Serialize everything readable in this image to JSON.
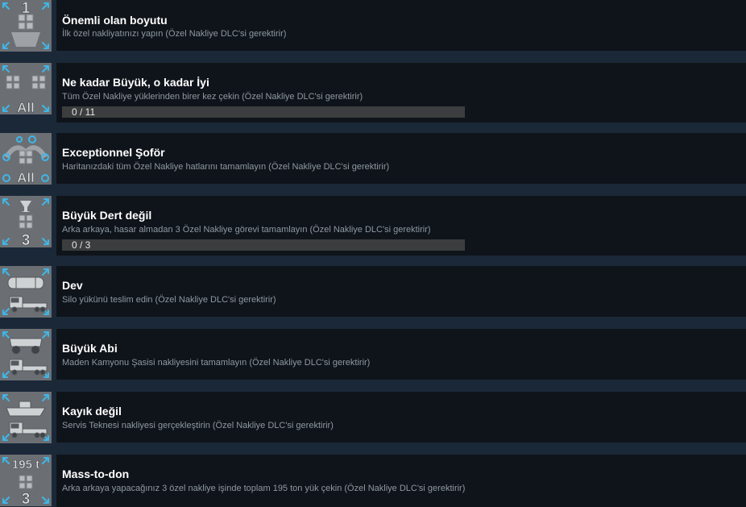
{
  "colors": {
    "background": "#1b2838",
    "panel": "#0f141a",
    "icon_bg": "#6b6f73",
    "icon_accent": "#3fb6e8",
    "title": "#ffffff",
    "description": "#8f98a0",
    "progress_track": "#3c3d3e"
  },
  "achievements": [
    {
      "title": "Önemli olan boyutu",
      "description": "İlk özel nakliyatınızı yapın (Özel Nakliye DLC'si gerektirir)",
      "icon": "number-one-crate-icon",
      "icon_label": "1"
    },
    {
      "title": "Ne kadar Büyük, o kadar İyi",
      "description": "Tüm Özel Nakliye yüklerinden birer kez çekin (Özel Nakliye DLC'si gerektirir)",
      "icon": "all-crates-icon",
      "icon_label": "All",
      "progress": {
        "current": 0,
        "total": 11,
        "text": "0 / 11"
      }
    },
    {
      "title": "Exceptionnel Şoför",
      "description": "Haritanızdaki tüm Özel Nakliye hatlarını tamamlayın (Özel Nakliye DLC'si gerektirir)",
      "icon": "all-routes-icon",
      "icon_label": "All"
    },
    {
      "title": "Büyük Dert değil",
      "description": "Arka arkaya, hasar almadan 3 Özel Nakliye görevi tamamlayın (Özel Nakliye DLC'si gerektirir)",
      "icon": "fragile-glass-icon",
      "icon_label": "3",
      "progress": {
        "current": 0,
        "total": 3,
        "text": "0 / 3"
      }
    },
    {
      "title": "Dev",
      "description": "Silo yükünü teslim edin (Özel Nakliye DLC'si gerektirir)",
      "icon": "silo-truck-icon",
      "icon_label": ""
    },
    {
      "title": "Büyük Abi",
      "description": "Maden Kamyonu Şasisi nakliyesini tamamlayın (Özel Nakliye DLC'si gerektirir)",
      "icon": "mining-truck-icon",
      "icon_label": ""
    },
    {
      "title": "Kayık değil",
      "description": "Servis Teknesi nakliyesi gerçekleştirin (Özel Nakliye DLC'si gerektirir)",
      "icon": "boat-truck-icon",
      "icon_label": ""
    },
    {
      "title": "Mass-to-don",
      "description": "Arka arkaya yapacağınız 3 özel nakliye işinde toplam 195 ton yük çekin (Özel Nakliye DLC'si gerektirir)",
      "icon": "weight-195t-icon",
      "icon_label": "3",
      "icon_top_label": "195 t"
    }
  ]
}
